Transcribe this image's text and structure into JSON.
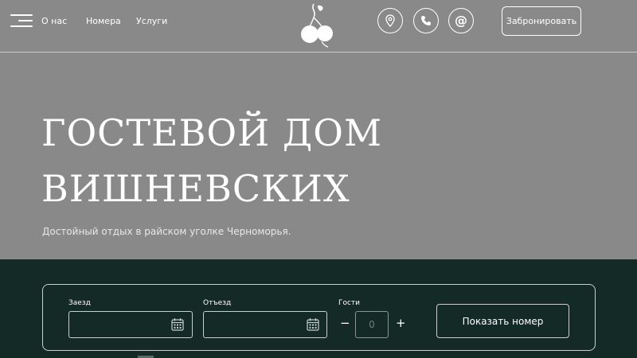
{
  "header": {
    "nav": {
      "about": "О нас",
      "rooms": "Номера",
      "services": "Услуги"
    },
    "icons": {
      "menu": "menu-icon",
      "logo": "cherry-logo-icon",
      "location": "location-pin-icon",
      "phone": "phone-icon",
      "email": "at-sign-icon"
    },
    "email_glyph": "@",
    "book_label": "Забронировать"
  },
  "hero": {
    "title_line1": "ГОСТЕВОЙ ДОМ",
    "title_line2": "ВИШНЕВСКИХ",
    "subtitle": "Достойный отдых в райском уголке Черноморья."
  },
  "booking": {
    "checkin_label": "Заезд",
    "checkout_label": "Отъезд",
    "guests_label": "Гости",
    "checkin_value": "",
    "checkout_value": "",
    "guests_value": "0",
    "minus": "−",
    "plus": "+",
    "submit_label": "Показать номер"
  },
  "colors": {
    "hero_bg": "#898989",
    "booking_bg": "#142a27",
    "text": "#ffffff"
  }
}
